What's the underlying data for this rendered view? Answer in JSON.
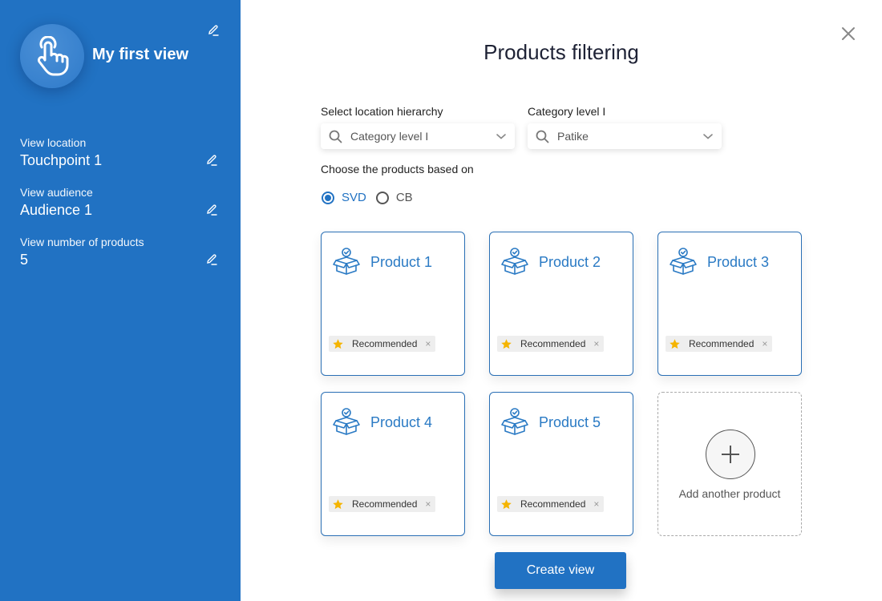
{
  "sidebar": {
    "title": "My first view",
    "avatar_icon": "pointer-hand-icon",
    "fields": [
      {
        "label": "View  location",
        "value": "Touchpoint 1"
      },
      {
        "label": "View  audience",
        "value": "Audience 1"
      },
      {
        "label": "View  number of products",
        "value": "5"
      }
    ]
  },
  "header": {
    "title": "Products filtering",
    "close_icon": "close-icon"
  },
  "filters": {
    "location": {
      "label": "Select location hierarchy",
      "value": "Category level I"
    },
    "category": {
      "label": "Category level I",
      "value": "Patike"
    },
    "choose_label": "Choose the products based on",
    "radios": [
      {
        "label": "SVD",
        "selected": true
      },
      {
        "label": "CB",
        "selected": false
      }
    ]
  },
  "products": [
    {
      "name": "Product 1",
      "tag": "Recommended"
    },
    {
      "name": "Product 2",
      "tag": "Recommended"
    },
    {
      "name": "Product 3",
      "tag": "Recommended"
    },
    {
      "name": "Product 4",
      "tag": "Recommended"
    },
    {
      "name": "Product 5",
      "tag": "Recommended"
    }
  ],
  "add_product": {
    "label": "Add another product"
  },
  "actions": {
    "create_label": "Create view"
  },
  "colors": {
    "primary": "#2172c3",
    "accent_text": "#2a7ac4",
    "star": "#f5b400"
  }
}
